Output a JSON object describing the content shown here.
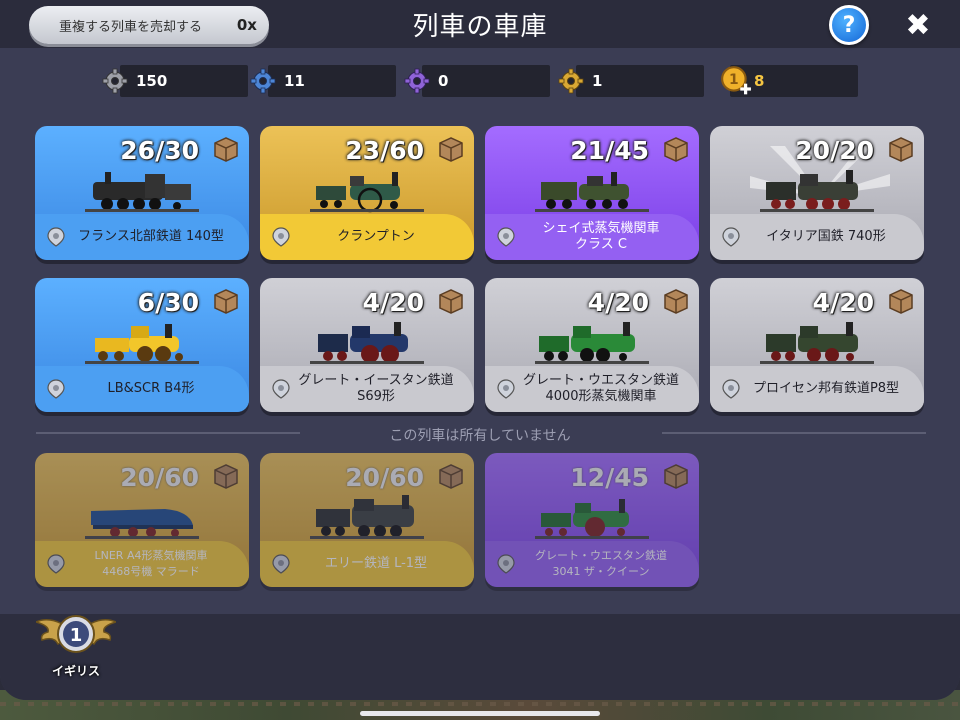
{
  "header": {
    "sell_duplicates_label": "重複する列車を売却する",
    "sell_duplicates_count": "0x",
    "title": "列車の車庫",
    "help_label": "?",
    "close_label": "✖"
  },
  "resources": [
    {
      "icon": "gray-gear-icon",
      "value": "150",
      "color": "#9ea0a8"
    },
    {
      "icon": "blue-gear-icon",
      "value": "11",
      "color": "#4d86d6"
    },
    {
      "icon": "purple-gear-icon",
      "value": "0",
      "color": "#8f63d8"
    },
    {
      "icon": "gold-gear-icon",
      "value": "1",
      "color": "#d9a834"
    },
    {
      "icon": "gold-coin-plus-icon",
      "value": "8",
      "color": "#f0b12a"
    }
  ],
  "owned_trains": [
    {
      "count": "26/30",
      "name": "フランス北部鉄道 140型",
      "rarity": "blue"
    },
    {
      "count": "23/60",
      "name": "クランプトン",
      "rarity": "gold"
    },
    {
      "count": "21/45",
      "name_line1": "シェイ式蒸気機関車",
      "name_line2": "クラス C",
      "rarity": "purple"
    },
    {
      "count": "20/20",
      "name": "イタリア国鉄 740形",
      "rarity": "gray"
    },
    {
      "count": "6/30",
      "name": "LB&SCR B4形",
      "rarity": "blue"
    },
    {
      "count": "4/20",
      "name_line1": "グレート・イースタン鉄道",
      "name_line2": "S69形",
      "rarity": "gray"
    },
    {
      "count": "4/20",
      "name_line1": "グレート・ウエスタン鉄道",
      "name_line2": "4000形蒸気機関車",
      "rarity": "gray"
    },
    {
      "count": "4/20",
      "name": "プロイセン邦有鉄道P8型",
      "rarity": "gray"
    }
  ],
  "not_owned_label": "この列車は所有していません",
  "locked_trains": [
    {
      "count": "20/60",
      "name_line1": "LNER A4形蒸気機関車",
      "name_line2": "4468号機 マラード",
      "rarity": "gold"
    },
    {
      "count": "20/60",
      "name": "エリー鉄道 L-1型",
      "rarity": "gold"
    },
    {
      "count": "12/45",
      "name_line1": "グレート・ウエスタン鉄道",
      "name_line2": "3041 ザ・クイーン",
      "rarity": "purple"
    }
  ],
  "region": {
    "level": "1",
    "name": "イギリス"
  },
  "colors": {
    "blue": "#4c9ff2",
    "gold": "#f2c936",
    "purple": "#9460f2",
    "gray": "#c9c9cf",
    "panel": "#3b3d54"
  }
}
